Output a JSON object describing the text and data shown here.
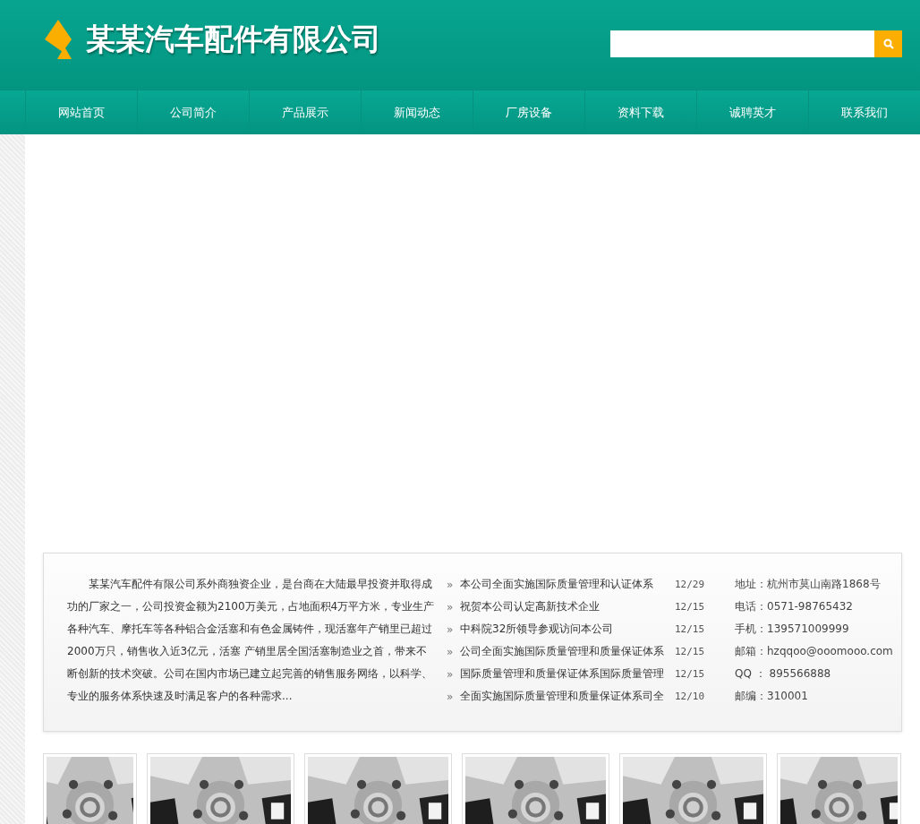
{
  "header": {
    "company_name": "某某汽车配件有限公司"
  },
  "nav": [
    {
      "label": "网站首页",
      "selected": false
    },
    {
      "label": "公司简介",
      "selected": false
    },
    {
      "label": "产品展示",
      "selected": false
    },
    {
      "label": "新闻动态",
      "selected": false
    },
    {
      "label": "厂房设备",
      "selected": false
    },
    {
      "label": "资料下载",
      "selected": false
    },
    {
      "label": "诚聘英才",
      "selected": false
    },
    {
      "label": "联系我们",
      "selected": false
    }
  ],
  "intro": "某某汽车配件有限公司系外商独资企业，是台商在大陆最早投资并取得成功的厂家之一，公司投资金额为2100万美元，占地面积4万平方米，专业生产各种汽车、摩托车等各种铝合金活塞和有色金属铸件，现活塞年产销里已超过2000万只，销售收入近3亿元，活塞 产销里居全国活塞制造业之首，带来不断创新的技术突破。公司在国内市场已建立起完善的销售服务网络，以科学、专业的服务体系快速及时满足客户的各种需求...",
  "news": [
    {
      "bullet": "»",
      "title": "本公司全面实施国际质量管理和认证体系",
      "date": "12/29"
    },
    {
      "bullet": "»",
      "title": "祝贺本公司认定高新技术企业",
      "date": "12/15"
    },
    {
      "bullet": "»",
      "title": "中科院32所领导参观访问本公司",
      "date": "12/15"
    },
    {
      "bullet": "»",
      "title": "公司全面实施国际质量管理和质量保证体系",
      "date": "12/15"
    },
    {
      "bullet": "»",
      "title": "国际质量管理和质量保证体系国际质量管理",
      "date": "12/15"
    },
    {
      "bullet": "»",
      "title": "全面实施国际质量管理和质量保证体系司全",
      "date": "12/10"
    }
  ],
  "contact": [
    "地址：杭州市莫山南路1868号",
    "电话：0571-98765432",
    "手机：139571009999",
    "邮箱：hzqqoo@ooomooo.com",
    "QQ ： 895566888",
    "邮编：310001"
  ]
}
